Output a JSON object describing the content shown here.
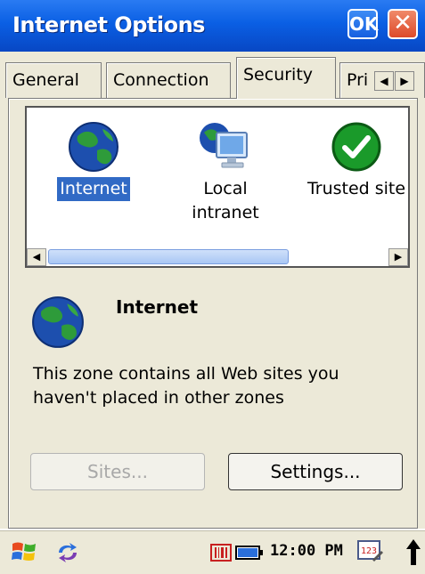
{
  "window": {
    "title": "Internet Options",
    "ok_label": "OK",
    "close_label": "✕"
  },
  "tabs": [
    {
      "label": "General",
      "active": false
    },
    {
      "label": "Connection",
      "active": false
    },
    {
      "label": "Security",
      "active": true
    },
    {
      "label": "Pri",
      "active": false
    }
  ],
  "zones": [
    {
      "line1": "Internet",
      "line2": "",
      "icon": "globe-icon",
      "selected": true
    },
    {
      "line1": "Local",
      "line2": "intranet",
      "icon": "intranet-monitor-icon",
      "selected": false
    },
    {
      "line1": "Trusted site",
      "line2": "",
      "icon": "trusted-check-icon",
      "selected": false
    }
  ],
  "selected_zone": {
    "name": "Internet",
    "description": "This zone contains all Web sites you haven't placed in other zones"
  },
  "buttons": {
    "sites": "Sites...",
    "settings": "Settings..."
  },
  "taskbar": {
    "clock": "12:00 PM"
  },
  "colors": {
    "titlebar": "#0a5fe4",
    "selection": "#316ac5",
    "face": "#ece9d8",
    "trusted_green": "#1a9a2a"
  }
}
